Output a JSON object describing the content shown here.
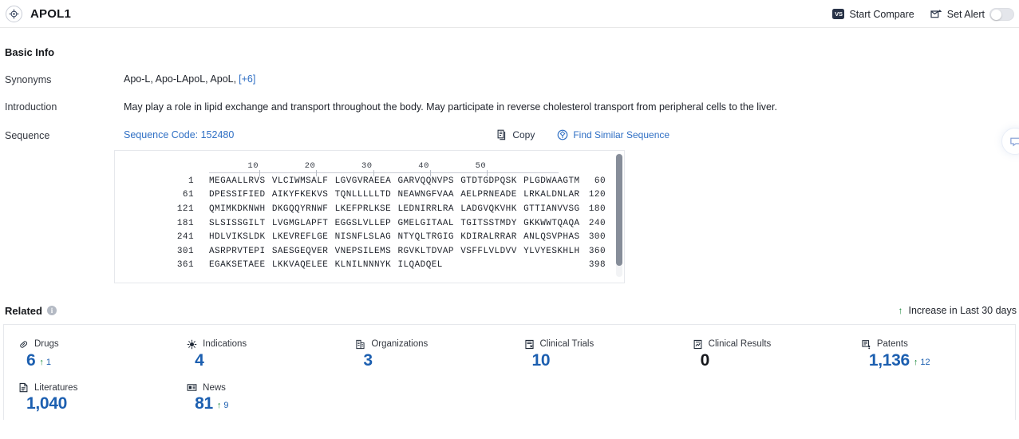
{
  "header": {
    "title": "APOL1",
    "logo_icon": "target-crosshair-icon",
    "start_compare_label": "Start Compare",
    "start_compare_icon": "vs-badge-icon",
    "set_alert_label": "Set Alert",
    "set_alert_icon": "alert-mail-icon",
    "alert_toggle_state": "off"
  },
  "basic_info": {
    "section_title": "Basic Info",
    "rows": {
      "synonyms_label": "Synonyms",
      "synonyms_value": "Apo-L, Apo-LApoL, ApoL,",
      "synonyms_more": "[+6]",
      "introduction_label": "Introduction",
      "introduction_value": "May play a role in lipid exchange and transport throughout the body. May participate in reverse cholesterol transport from peripheral cells to the liver.",
      "sequence_label": "Sequence",
      "sequence_code": "Sequence Code: 152480"
    },
    "tools": {
      "copy_label": "Copy",
      "copy_icon": "copy-icon",
      "find_similar_label": "Find Similar Sequence",
      "find_similar_icon": "find-similar-sequence-icon"
    }
  },
  "sequence_viewer": {
    "ruler_ticks": [
      "10",
      "20",
      "30",
      "40",
      "50"
    ],
    "lines": [
      {
        "start": "1",
        "chunks": [
          "MEGAALLRVS",
          "VLCIWMSALF",
          "LGVGVRAEEA",
          "GARVQQNVPS",
          "GTDTGDPQSK",
          "PLGDWAAGTM"
        ],
        "end": "60"
      },
      {
        "start": "61",
        "chunks": [
          "DPESSIFIED",
          "AIKYFKEKVS",
          "TQNLLLLLTD",
          "NEAWNGFVAA",
          "AELPRNEADE",
          "LRKALDNLAR"
        ],
        "end": "120"
      },
      {
        "start": "121",
        "chunks": [
          "QMIMKDKNWH",
          "DKGQQYRNWF",
          "LKEFPRLKSE",
          "LEDNIRRLRA",
          "LADGVQKVHK",
          "GTTIANVVSG"
        ],
        "end": "180"
      },
      {
        "start": "181",
        "chunks": [
          "SLSISSGILT",
          "LVGMGLAPFT",
          "EGGSLVLLEP",
          "GMELGITAAL",
          "TGITSSTMDY",
          "GKKWWTQAQA"
        ],
        "end": "240"
      },
      {
        "start": "241",
        "chunks": [
          "HDLVIKSLDK",
          "LKEVREFLGE",
          "NISNFLSLAG",
          "NTYQLTRGIG",
          "KDIRALRRAR",
          "ANLQSVPHAS"
        ],
        "end": "300"
      },
      {
        "start": "301",
        "chunks": [
          "ASRPRVTEPI",
          "SAESGEQVER",
          "VNEPSILEMS",
          "RGVKLTDVAP",
          "VSFFLVLDVV",
          "YLVYESKHLH"
        ],
        "end": "360"
      },
      {
        "start": "361",
        "chunks": [
          "EGAKSETAEE",
          "LKKVAQELEE",
          "KLNILNNNYK",
          "ILQADQEL"
        ],
        "end": "398"
      }
    ]
  },
  "related": {
    "title": "Related",
    "info_icon": "info-icon",
    "info_glyph": "i",
    "increase_note": "Increase in Last 30 days",
    "increase_arrow": "↑",
    "cards": [
      {
        "label": "Drugs",
        "icon": "pill-icon",
        "value": "6",
        "delta": "1",
        "is_zero": false
      },
      {
        "label": "Indications",
        "icon": "virus-icon",
        "value": "4",
        "delta": "",
        "is_zero": false
      },
      {
        "label": "Organizations",
        "icon": "building-icon",
        "value": "3",
        "delta": "",
        "is_zero": false
      },
      {
        "label": "Clinical Trials",
        "icon": "clipboard-flask-icon",
        "value": "10",
        "delta": "",
        "is_zero": false
      },
      {
        "label": "Clinical Results",
        "icon": "results-chart-icon",
        "value": "0",
        "delta": "",
        "is_zero": true
      },
      {
        "label": "Patents",
        "icon": "patent-doc-icon",
        "value": "1,136",
        "delta": "12",
        "is_zero": false
      },
      {
        "label": "Literatures",
        "icon": "book-icon",
        "value": "1,040",
        "delta": "",
        "is_zero": false
      },
      {
        "label": "News",
        "icon": "newspaper-icon",
        "value": "81",
        "delta": "9",
        "is_zero": false
      }
    ]
  },
  "edge_fab": {
    "icon": "chat-bubble-icon"
  }
}
